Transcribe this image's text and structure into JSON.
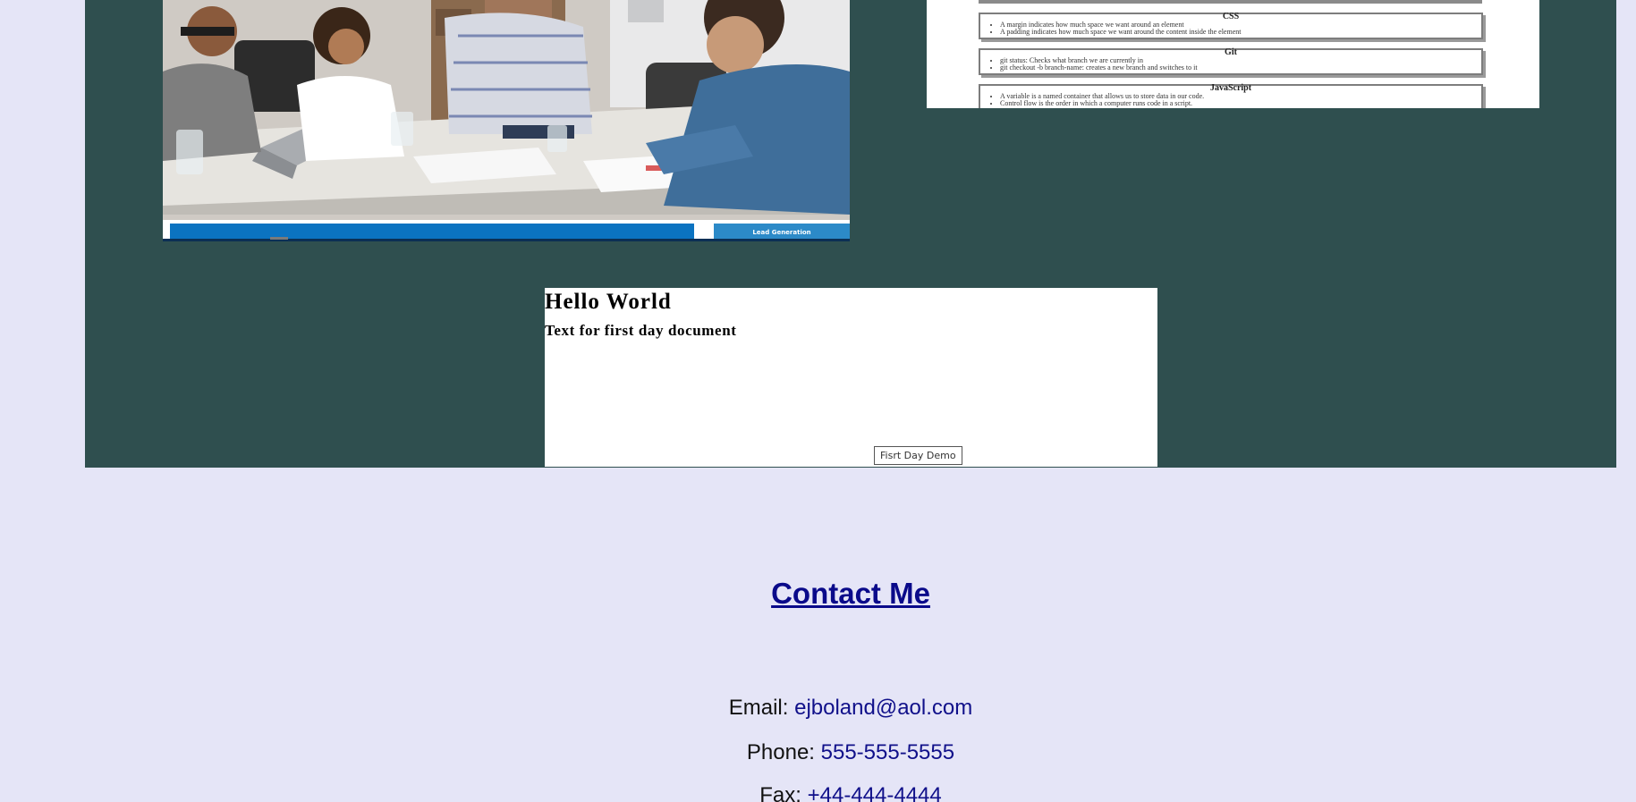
{
  "portfolio": {
    "background": "#2f4f4f",
    "photo_card": {
      "caption_label": "Lead Generation"
    },
    "notes_card": {
      "sections": [
        {
          "title": "CSS",
          "items": [
            "A margin indicates how much space we want around an element",
            "A padding indicates how much space we want around the content inside the element"
          ]
        },
        {
          "title": "Git",
          "items": [
            "git status: Checks what branch we are currently in",
            "git checkout -b branch-name: creates a new branch and switches to it"
          ]
        },
        {
          "title": "JavaScript",
          "items": [
            "A variable is a named container that allows us to store data in our code.",
            "Control flow is the order in which a computer runs code in a script."
          ]
        }
      ]
    },
    "hello_card": {
      "title": "Hello World",
      "subtitle": "Text for first day document",
      "label": "Fisrt Day Demo"
    }
  },
  "contact": {
    "heading": "Contact Me",
    "email_label": "Email:",
    "email_value": "ejboland@aol.com",
    "phone_label": "Phone:",
    "phone_value": "555-555-5555",
    "fax_label": "Fax:",
    "fax_value": "+44-444-4444"
  },
  "colors": {
    "page_background": "#e5e5f7",
    "link": "#10108a"
  }
}
